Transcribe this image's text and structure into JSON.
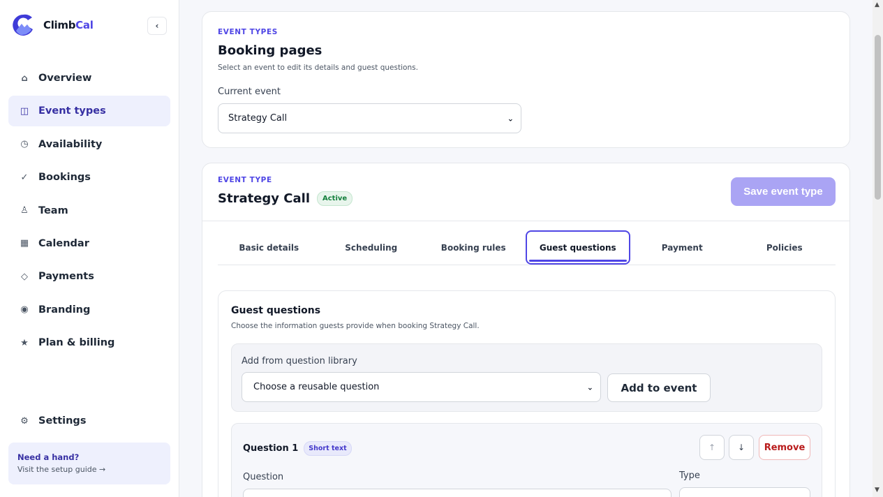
{
  "app": {
    "name_part1": "Climb",
    "name_part2": "Cal",
    "collapse_icon": "chevron-left-icon",
    "accent_color": "#4f46e5"
  },
  "sidebar": {
    "items": [
      {
        "label": "Overview",
        "icon": "home-icon",
        "glyph": "⌂"
      },
      {
        "label": "Event types",
        "icon": "columns-icon",
        "glyph": "◫",
        "active": true
      },
      {
        "label": "Availability",
        "icon": "clock-icon",
        "glyph": "◷"
      },
      {
        "label": "Bookings",
        "icon": "check-icon",
        "glyph": "✓"
      },
      {
        "label": "Team",
        "icon": "person-icon",
        "glyph": "♙"
      },
      {
        "label": "Calendar",
        "icon": "calendar-icon",
        "glyph": "▦"
      },
      {
        "label": "Payments",
        "icon": "diamond-icon",
        "glyph": "◇"
      },
      {
        "label": "Branding",
        "icon": "circle-dot-icon",
        "glyph": "◉"
      },
      {
        "label": "Plan & billing",
        "icon": "star-icon",
        "glyph": "★"
      }
    ],
    "settings": {
      "label": "Settings",
      "icon": "gear-icon",
      "glyph": "⚙"
    },
    "help": {
      "title": "Need a hand?",
      "subtitle": "Visit the setup guide →"
    }
  },
  "event_types_card": {
    "eyebrow": "EVENT TYPES",
    "title": "Booking pages",
    "description": "Select an event to edit its details and guest questions.",
    "current_event_label": "Current event",
    "current_event_value": "Strategy Call"
  },
  "event_type_card": {
    "eyebrow": "EVENT TYPE",
    "title": "Strategy Call",
    "status_badge": "Active",
    "save_label": "Save event type",
    "tabs": [
      {
        "label": "Basic details"
      },
      {
        "label": "Scheduling"
      },
      {
        "label": "Booking rules"
      },
      {
        "label": "Guest questions",
        "active": true
      },
      {
        "label": "Payment"
      },
      {
        "label": "Policies"
      }
    ]
  },
  "guest_questions": {
    "title": "Guest questions",
    "description": "Choose the information guests provide when booking Strategy Call.",
    "library_label": "Add from question library",
    "library_select_value": "Choose a reusable question",
    "add_button": "Add to event",
    "question": {
      "heading": "Question 1",
      "type_badge": "Short text",
      "move_up": "↑",
      "move_down": "↓",
      "remove_label": "Remove",
      "question_field_label": "Question",
      "type_field_label": "Type"
    }
  }
}
